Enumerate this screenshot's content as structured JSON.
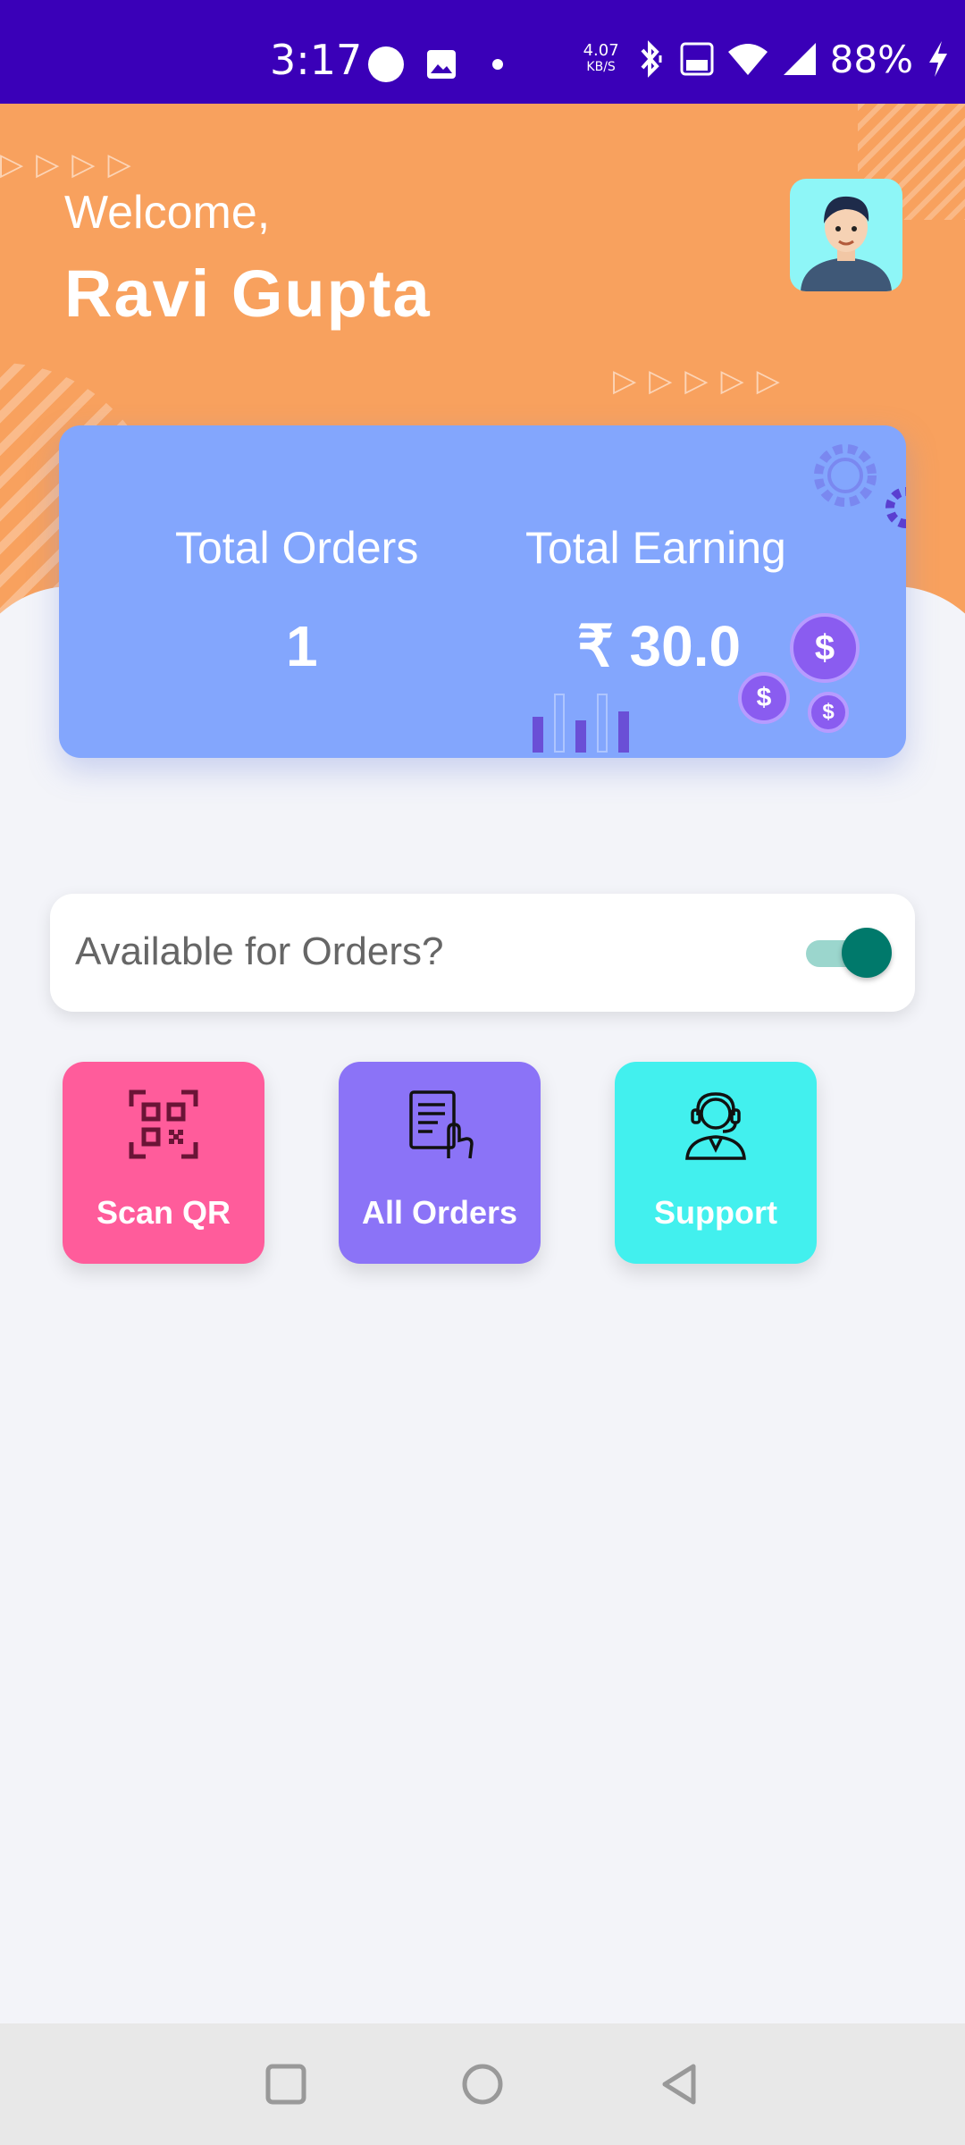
{
  "status_bar": {
    "time": "3:17",
    "net_speed_value": "4.07",
    "net_speed_unit": "KB/S",
    "battery": "88%",
    "icons": [
      "circle-icon",
      "image-icon",
      "dot-icon",
      "bluetooth-icon",
      "volte-icon",
      "wifi-icon",
      "signal-icon",
      "charging-icon"
    ]
  },
  "header": {
    "welcome": "Welcome,",
    "user_name": "Ravi Gupta"
  },
  "stats": {
    "orders_label": "Total Orders",
    "orders_value": "1",
    "earning_label": "Total Earning",
    "earning_value": "₹ 30.0",
    "coin_symbol": "$"
  },
  "availability": {
    "label": "Available for Orders?",
    "enabled": true
  },
  "actions": {
    "scan": {
      "label": "Scan QR",
      "color": "#ff5c9b"
    },
    "orders": {
      "label": "All Orders",
      "color": "#8b73f7"
    },
    "support": {
      "label": "Support",
      "color": "#42f0ee"
    }
  },
  "colors": {
    "status_bar": "#3a00b8",
    "header": "#f8a15e",
    "stats_card": "#83a6fd",
    "toggle": "#00796b"
  }
}
